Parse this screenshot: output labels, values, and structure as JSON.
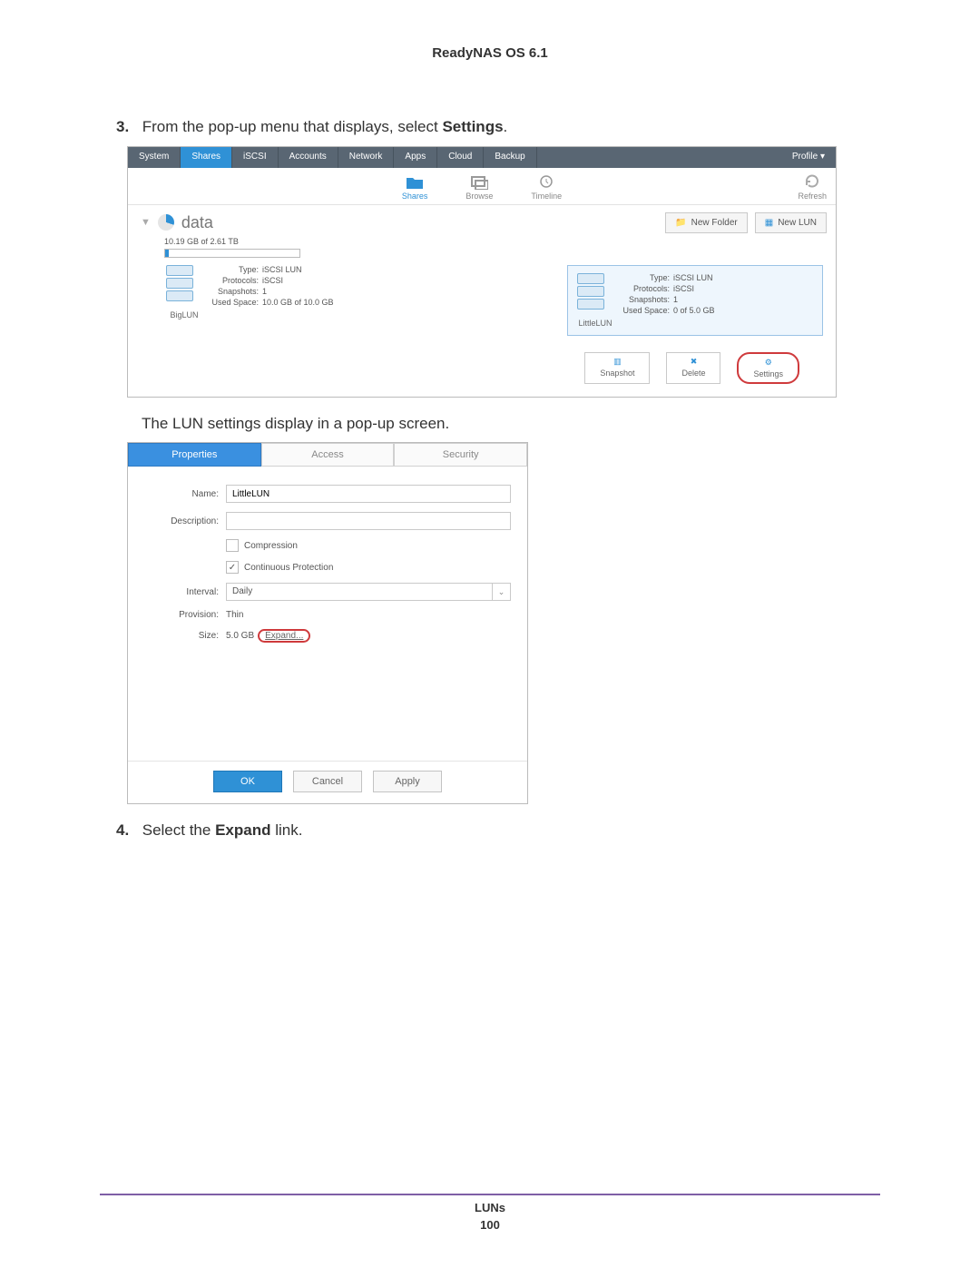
{
  "doc_title": "ReadyNAS OS 6.1",
  "steps": {
    "s3": {
      "num": "3.",
      "text_a": "From the pop-up menu that displays, select ",
      "bold": "Settings",
      "tail": "."
    },
    "mid": "The LUN settings display in a pop-up screen.",
    "s4": {
      "num": "4.",
      "text_a": "Select the ",
      "bold": "Expand",
      "tail": " link."
    }
  },
  "nav": {
    "tabs": [
      "System",
      "Shares",
      "iSCSI",
      "Accounts",
      "Network",
      "Apps",
      "Cloud",
      "Backup"
    ],
    "profile": "Profile ▾"
  },
  "toolbar": {
    "shares": "Shares",
    "browse": "Browse",
    "timeline": "Timeline",
    "refresh": "Refresh"
  },
  "volume": {
    "name": "data",
    "usage": "10.19 GB of 2.61 TB",
    "new_folder": "New Folder",
    "new_lun": "New LUN"
  },
  "luns": {
    "big": {
      "name": "BigLUN",
      "type_k": "Type:",
      "type_v": "iSCSI LUN",
      "proto_k": "Protocols:",
      "proto_v": "iSCSI",
      "snap_k": "Snapshots:",
      "snap_v": "1",
      "used_k": "Used Space:",
      "used_v": "10.0 GB of 10.0 GB"
    },
    "little": {
      "name": "LittleLUN",
      "type_k": "Type:",
      "type_v": "iSCSI LUN",
      "proto_k": "Protocols:",
      "proto_v": "iSCSI",
      "snap_k": "Snapshots:",
      "snap_v": "1",
      "used_k": "Used Space:",
      "used_v": "0 of 5.0 GB"
    }
  },
  "actions": {
    "snapshot": "Snapshot",
    "delete": "Delete",
    "settings": "Settings"
  },
  "dialog": {
    "tabs": {
      "properties": "Properties",
      "access": "Access",
      "security": "Security"
    },
    "labels": {
      "name": "Name:",
      "description": "Description:",
      "compression": "Compression",
      "continuous": "Continuous Protection",
      "interval": "Interval:",
      "provision": "Provision:",
      "size": "Size:"
    },
    "values": {
      "name": "LittleLUN",
      "description": "",
      "interval": "Daily",
      "provision": "Thin",
      "size": "5.0 GB",
      "expand": "Expand..."
    },
    "buttons": {
      "ok": "OK",
      "cancel": "Cancel",
      "apply": "Apply"
    }
  },
  "footer": {
    "section": "LUNs",
    "page": "100"
  }
}
